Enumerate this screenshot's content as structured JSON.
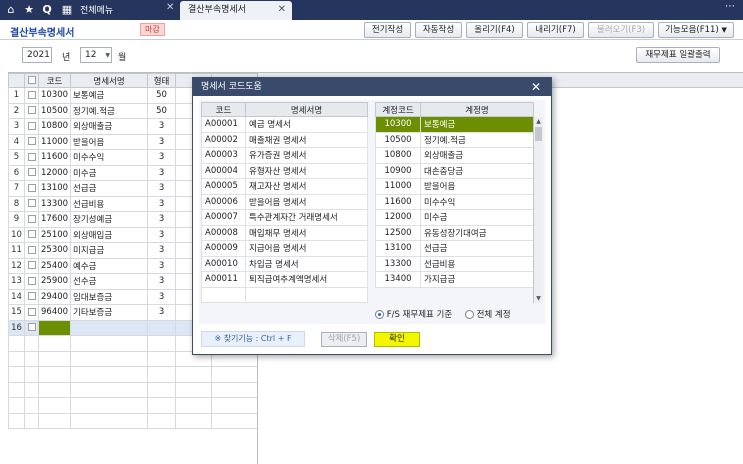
{
  "nav": {
    "tab_all": "전체메뉴",
    "tab_active": "결산부속명세서",
    "close": "✕",
    "more": "⋯"
  },
  "header": {
    "title": "결산부속명세서",
    "badge": "마감",
    "buttons": {
      "create": "전기작성",
      "auto": "자동작성",
      "pull": "올리기(F4)",
      "push": "내리기(F7)",
      "import": "불러오기(F3)",
      "tools": "기능모음(F11)"
    }
  },
  "filter": {
    "year": "2021",
    "year_unit": "년",
    "month": "12",
    "month_unit": "월",
    "print_button": "재무제표 일괄출력"
  },
  "grid": {
    "headers": {
      "code": "코드",
      "name": "명세서명",
      "type": "형태"
    },
    "rows": [
      {
        "no": "1",
        "code": "10300",
        "name": "보통예금",
        "type": "50"
      },
      {
        "no": "2",
        "code": "10500",
        "name": "정기예.적금",
        "type": "50"
      },
      {
        "no": "3",
        "code": "10800",
        "name": "외상매출금",
        "type": "3"
      },
      {
        "no": "4",
        "code": "11000",
        "name": "받을어음",
        "type": "3"
      },
      {
        "no": "5",
        "code": "11600",
        "name": "미수수익",
        "type": "3"
      },
      {
        "no": "6",
        "code": "12000",
        "name": "미수금",
        "type": "3"
      },
      {
        "no": "7",
        "code": "13100",
        "name": "선급금",
        "type": "3"
      },
      {
        "no": "8",
        "code": "13300",
        "name": "선급비용",
        "type": "3"
      },
      {
        "no": "9",
        "code": "17600",
        "name": "장기성예금",
        "type": "3"
      },
      {
        "no": "10",
        "code": "25100",
        "name": "외상매입금",
        "type": "3"
      },
      {
        "no": "11",
        "code": "25300",
        "name": "미지급금",
        "type": "3"
      },
      {
        "no": "12",
        "code": "25400",
        "name": "예수금",
        "type": "3"
      },
      {
        "no": "13",
        "code": "25900",
        "name": "선수금",
        "type": "3"
      },
      {
        "no": "14",
        "code": "29400",
        "name": "임대보증금",
        "type": "3"
      },
      {
        "no": "15",
        "code": "96400",
        "name": "기타보증금",
        "type": "3"
      },
      {
        "no": "16",
        "code": "",
        "name": "",
        "type": ""
      }
    ]
  },
  "dialog": {
    "title": "명세서 코드도움",
    "left_headers": {
      "code": "코드",
      "name": "명세서명"
    },
    "left_rows": [
      {
        "code": "A00001",
        "name": "예금 명세서"
      },
      {
        "code": "A00002",
        "name": "매출채권 명세서"
      },
      {
        "code": "A00003",
        "name": "유가증권 명세서"
      },
      {
        "code": "A00004",
        "name": "유형자산 명세서"
      },
      {
        "code": "A00005",
        "name": "재고자산 명세서"
      },
      {
        "code": "A00006",
        "name": "받을어음 명세서"
      },
      {
        "code": "A00007",
        "name": "특수관계자간 거래명세서"
      },
      {
        "code": "A00008",
        "name": "매입채무 명세서"
      },
      {
        "code": "A00009",
        "name": "지급어음 명세서"
      },
      {
        "code": "A00010",
        "name": "차입금 명세서"
      },
      {
        "code": "A00011",
        "name": "퇴직급여추계액명세서"
      }
    ],
    "right_headers": {
      "code": "계정코드",
      "name": "계정명"
    },
    "right_rows": [
      {
        "code": "10300",
        "name": "보통예금"
      },
      {
        "code": "10500",
        "name": "정기예.적금"
      },
      {
        "code": "10800",
        "name": "외상매출금"
      },
      {
        "code": "10900",
        "name": "대손충당금"
      },
      {
        "code": "11000",
        "name": "받을어음"
      },
      {
        "code": "11600",
        "name": "미수수익"
      },
      {
        "code": "12000",
        "name": "미수금"
      },
      {
        "code": "12500",
        "name": "유동성장기대여금"
      },
      {
        "code": "13100",
        "name": "선급금"
      },
      {
        "code": "13300",
        "name": "선급비용"
      },
      {
        "code": "13400",
        "name": "가지급금"
      }
    ],
    "radio_fs": "F/S 재무제표 기준",
    "radio_all": "전체 계정",
    "hint": "※ 찾기기능 : Ctrl + F",
    "delete_button": "삭제(F5)",
    "confirm_button": "확인"
  }
}
